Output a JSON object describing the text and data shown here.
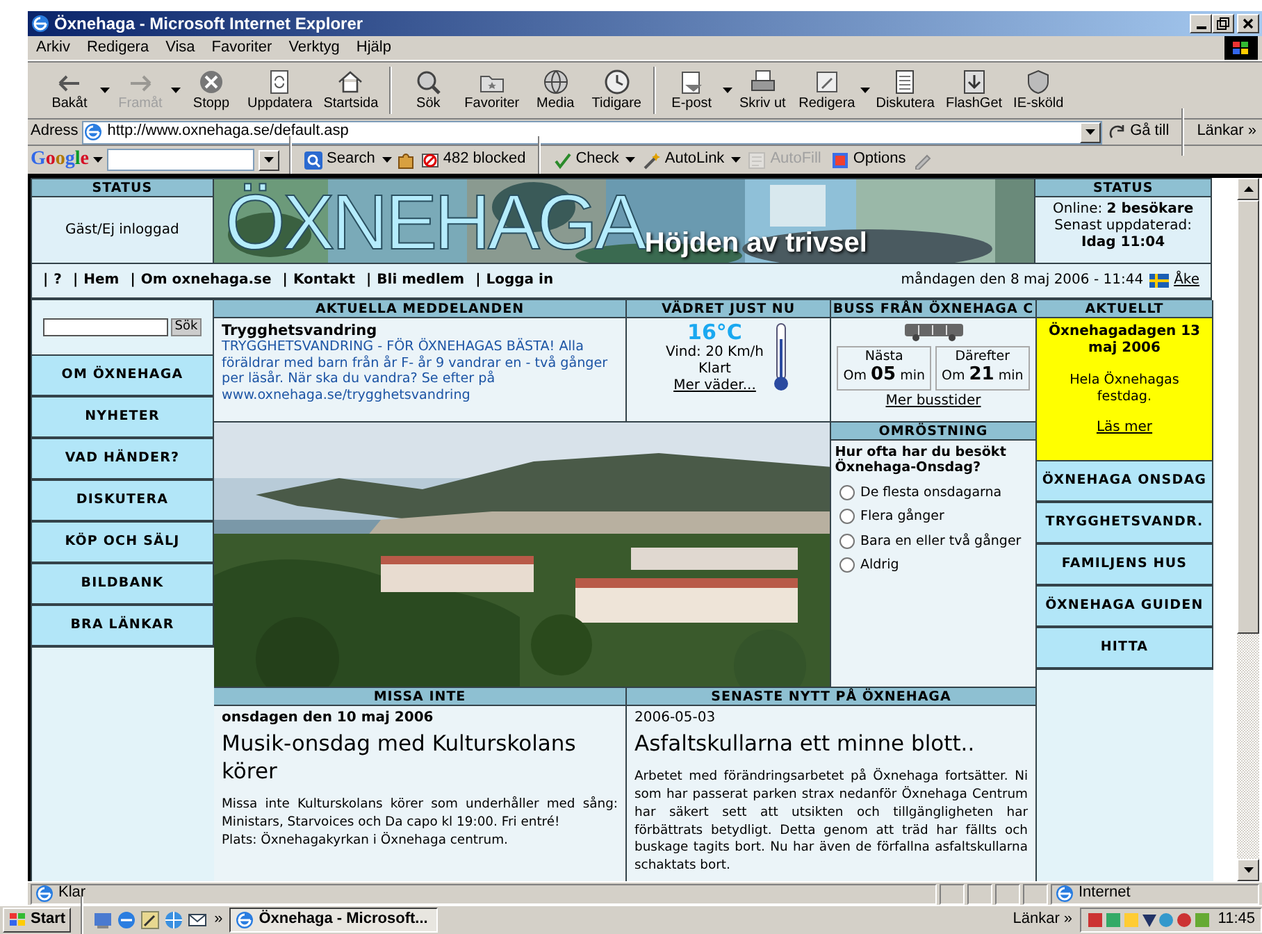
{
  "window": {
    "title": "Öxnehaga - Microsoft Internet Explorer"
  },
  "menu": [
    "Arkiv",
    "Redigera",
    "Visa",
    "Favoriter",
    "Verktyg",
    "Hjälp"
  ],
  "toolbar": [
    {
      "label": "Bakåt",
      "disabled": false,
      "dropdown": true
    },
    {
      "label": "Framåt",
      "disabled": true,
      "dropdown": true
    },
    {
      "label": "Stopp",
      "disabled": false,
      "dropdown": false
    },
    {
      "label": "Uppdatera",
      "disabled": false,
      "dropdown": false
    },
    {
      "label": "Startsida",
      "disabled": false,
      "dropdown": false
    },
    {
      "label": "Sök",
      "disabled": false,
      "dropdown": false
    },
    {
      "label": "Favoriter",
      "disabled": false,
      "dropdown": false
    },
    {
      "label": "Media",
      "disabled": false,
      "dropdown": false
    },
    {
      "label": "Tidigare",
      "disabled": false,
      "dropdown": false
    },
    {
      "label": "E-post",
      "disabled": false,
      "dropdown": true
    },
    {
      "label": "Skriv ut",
      "disabled": false,
      "dropdown": false
    },
    {
      "label": "Redigera",
      "disabled": false,
      "dropdown": true
    },
    {
      "label": "Diskutera",
      "disabled": false,
      "dropdown": false
    },
    {
      "label": "FlashGet",
      "disabled": false,
      "dropdown": false
    },
    {
      "label": "IE-sköld",
      "disabled": false,
      "dropdown": false
    }
  ],
  "address": {
    "label": "Adress",
    "url": "http://www.oxnehaga.se/default.asp",
    "go": "Gå till",
    "links": "Länkar",
    "more": "»"
  },
  "google": {
    "logo": "Google",
    "items": [
      {
        "label": "Search",
        "disabled": false,
        "dropdown": true
      },
      {
        "label": "482 blocked",
        "disabled": false,
        "dropdown": false
      },
      {
        "label": "Check",
        "disabled": false,
        "dropdown": true
      },
      {
        "label": "AutoLink",
        "disabled": false,
        "dropdown": true
      },
      {
        "label": "AutoFill",
        "disabled": true,
        "dropdown": false
      },
      {
        "label": "Options",
        "disabled": false,
        "dropdown": false
      }
    ]
  },
  "page": {
    "status_left": {
      "header": "STATUS",
      "text": "Gäst/Ej inloggad"
    },
    "banner": {
      "title": "ÖXNEHAGA",
      "slogan": "Höjden av trivsel"
    },
    "status_right": {
      "header": "STATUS",
      "online_label": "Online:",
      "online_value": "2 besökare",
      "updated_label": "Senast uppdaterad:",
      "updated_value": "Idag 11:04"
    },
    "nav": {
      "separator": "|",
      "links": [
        "?",
        "Hem",
        "Om oxnehaga.se",
        "Kontakt",
        "Bli medlem",
        "Logga in"
      ],
      "date": "måndagen den 8 maj 2006 - 11:44",
      "user": "Åke"
    },
    "search": {
      "button": "Sök"
    },
    "left_menu": [
      "OM ÖXNEHAGA",
      "NYHETER",
      "VAD HÄNDER?",
      "DISKUTERA",
      "KÖP OCH SÄLJ",
      "BILDBANK",
      "BRA LÄNKAR"
    ],
    "news": {
      "header": "AKTUELLA MEDDELANDEN",
      "title": "Trygghetsvandring",
      "body": "TRYGGHETSVANDRING - FÖR ÖXNEHAGAS BÄSTA! Alla föräldrar med barn från år F- år 9 vandrar en - två gånger per läsår. När ska du vandra? Se efter på www.oxnehaga.se/trygghetsvandring"
    },
    "weather": {
      "header": "VÄDRET JUST NU",
      "temp": "16°C",
      "wind": "Vind: 20 Km/h",
      "sky": "Klart",
      "link": "Mer väder..."
    },
    "bus": {
      "header": "BUSS FRÅN ÖXNEHAGA C",
      "departures": [
        {
          "label": "Nästa",
          "time": "Om **05** min"
        },
        {
          "label": "Därefter",
          "time": "Om **21** min"
        }
      ],
      "link": "Mer busstider"
    },
    "aktuellt": {
      "header": "AKTUELLT",
      "title": "Öxnehagadagen 13 maj 2006",
      "body": "Hela Öxnehagas festdag.",
      "link": "Läs mer"
    },
    "poll": {
      "header": "OMRÖSTNING",
      "question": "Hur ofta har du besökt Öxnehaga-Onsdag?",
      "options": [
        {
          "label": "De flesta onsdagarna",
          "selected": false
        },
        {
          "label": "Flera gånger",
          "selected": false
        },
        {
          "label": "Bara en eller två gånger",
          "selected": false
        },
        {
          "label": "Aldrig",
          "selected": false
        }
      ]
    },
    "right_menu": [
      "ÖXNEHAGA ONSDAG",
      "TRYGGHETSVANDR.",
      "FAMILJENS HUS",
      "ÖXNEHAGA GUIDEN",
      "HITTA"
    ],
    "missa": {
      "header": "MISSA INTE",
      "date": "onsdagen den 10 maj 2006",
      "title": "Musik-onsdag med Kulturskolans körer",
      "body": [
        "Missa inte Kulturskolans körer som underhåller med sång: Ministars, Starvoices och Da capo kl 19:00. Fri entré!",
        "Plats: Öxnehagakyrkan i Öxnehaga centrum."
      ]
    },
    "senaste": {
      "header": "SENASTE NYTT PÅ ÖXNEHAGA",
      "date": "2006-05-03",
      "title": "Asfaltskullarna ett minne blott..",
      "body": [
        "Arbetet med förändringsarbetet på Öxnehaga fortsätter. Ni som har passerat parken strax nedanför Öxnehaga Centrum har säkert sett att utsikten och tillgängligheten har förbättrats betydligt. Detta genom att träd har fällts och buskage tagits bort. Nu har även de förfallna asfaltskullarna schaktats bort."
      ]
    }
  },
  "status_bar": {
    "text": "Klar",
    "zone": "Internet"
  },
  "taskbar": {
    "start": "Start",
    "more": "»",
    "task": "Öxnehaga - Microsoft...",
    "links": "Länkar",
    "links_more": "»",
    "clock": "11:45"
  }
}
